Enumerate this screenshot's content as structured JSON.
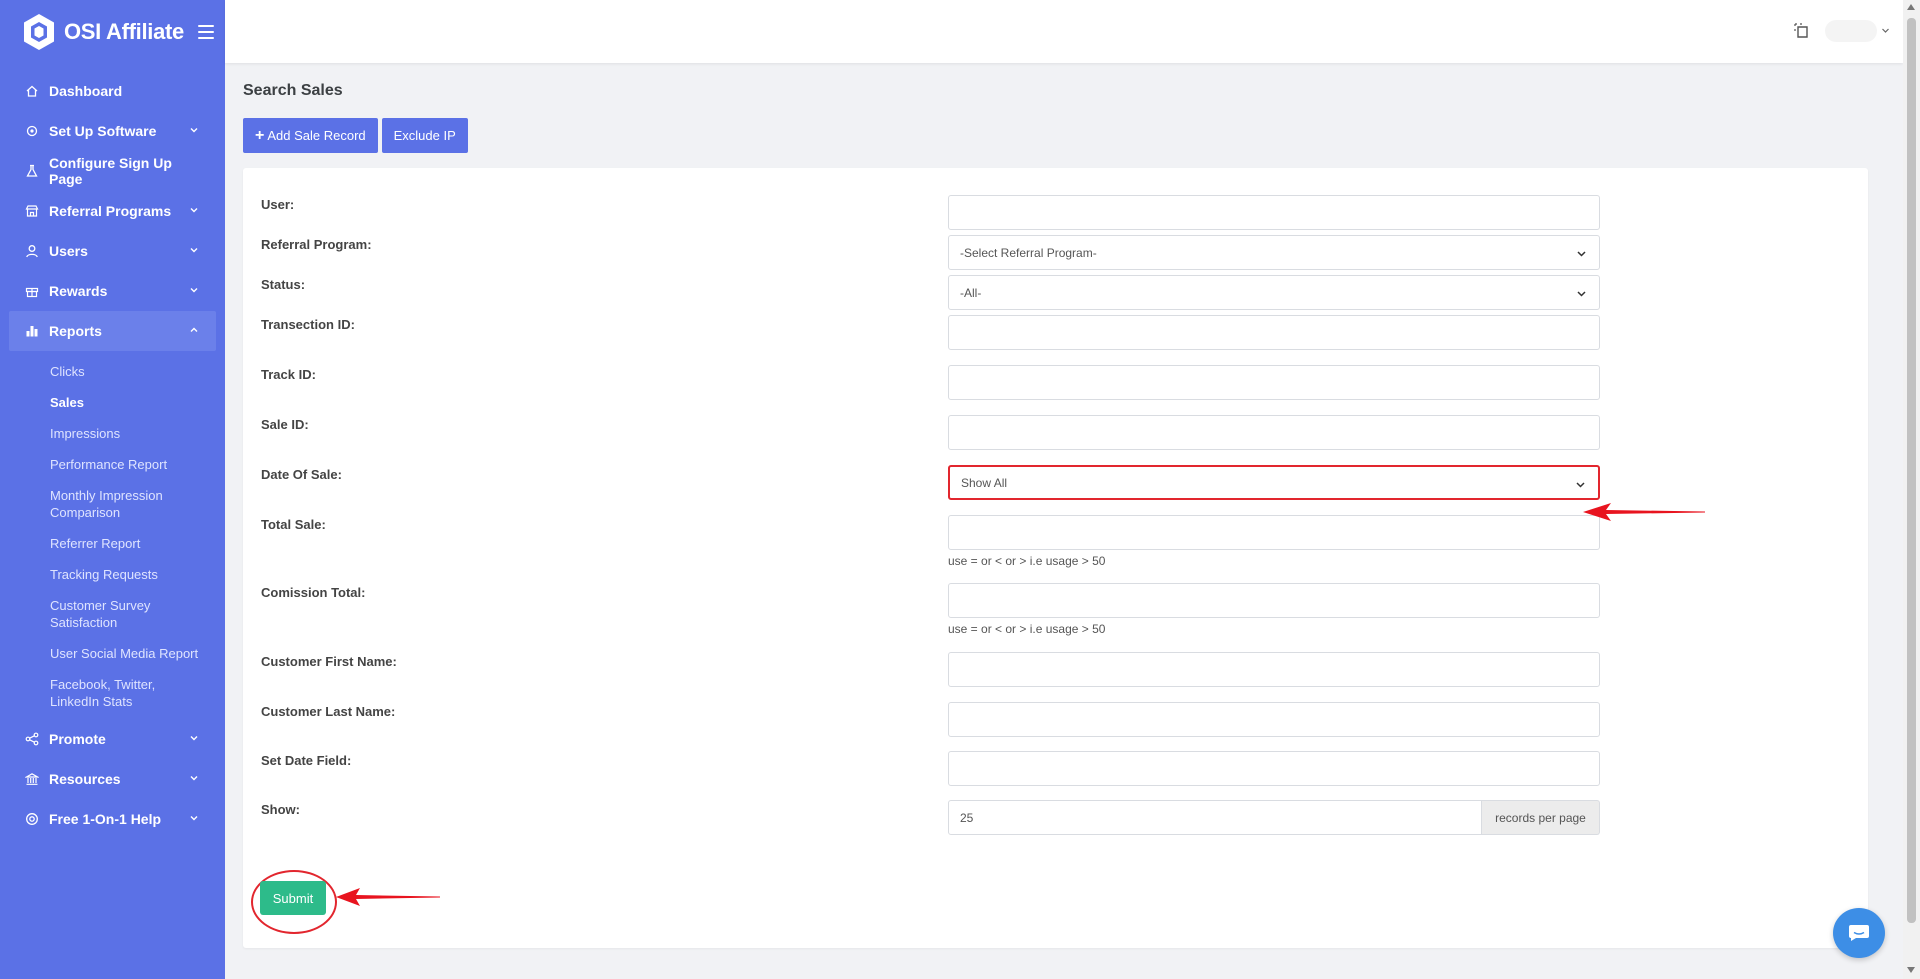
{
  "app": {
    "name": "OSI Affiliate"
  },
  "sidebar": {
    "items": [
      {
        "label": "Dashboard",
        "icon": "home-icon",
        "has_chevron": false
      },
      {
        "label": "Set Up Software",
        "icon": "gear-icon",
        "has_chevron": true
      },
      {
        "label": "Configure Sign Up Page",
        "icon": "flask-icon",
        "has_chevron": false
      },
      {
        "label": "Referral Programs",
        "icon": "store-icon",
        "has_chevron": true
      },
      {
        "label": "Users",
        "icon": "user-icon",
        "has_chevron": true
      },
      {
        "label": "Rewards",
        "icon": "gift-icon",
        "has_chevron": true
      },
      {
        "label": "Reports",
        "icon": "chart-icon",
        "has_chevron": true,
        "expanded": true
      }
    ],
    "reports_sub": [
      {
        "label": "Clicks"
      },
      {
        "label": "Sales",
        "current": true
      },
      {
        "label": "Impressions"
      },
      {
        "label": "Performance Report"
      },
      {
        "label": "Monthly Impression Comparison"
      },
      {
        "label": "Referrer Report"
      },
      {
        "label": "Tracking Requests"
      },
      {
        "label": "Customer Survey Satisfaction"
      },
      {
        "label": "User Social Media Report"
      },
      {
        "label": "Facebook, Twitter, LinkedIn Stats"
      }
    ],
    "items_after": [
      {
        "label": "Promote",
        "icon": "share-icon"
      },
      {
        "label": "Resources",
        "icon": "bank-icon"
      },
      {
        "label": "Free 1-On-1 Help",
        "icon": "lifebuoy-icon"
      }
    ]
  },
  "page": {
    "title": "Search Sales",
    "add_sale_label": "Add Sale Record",
    "exclude_ip_label": "Exclude IP"
  },
  "form": {
    "user_label": "User:",
    "user_value": "",
    "referral_program_label": "Referral Program:",
    "referral_program_value": "-Select Referral Program-",
    "status_label": "Status:",
    "status_value": "-All-",
    "transection_id_label": "Transection ID:",
    "track_id_label": "Track ID:",
    "sale_id_label": "Sale ID:",
    "date_of_sale_label": "Date Of Sale:",
    "date_of_sale_value": "Show All",
    "total_sale_label": "Total Sale:",
    "total_sale_hint": "use = or < or > i.e usage > 50",
    "commission_total_label": "Comission Total:",
    "commission_total_hint": "use = or < or > i.e usage > 50",
    "customer_first_name_label": "Customer First Name:",
    "customer_last_name_label": "Customer Last Name:",
    "set_date_field_label": "Set Date Field:",
    "show_label": "Show:",
    "show_value": "25",
    "show_addon": "records per page",
    "submit_label": "Submit"
  },
  "colors": {
    "sidebar": "#5b71e6",
    "primary_button": "#5b71e6",
    "submit_button": "#2dbb8a",
    "annotation": "#e2262e"
  }
}
